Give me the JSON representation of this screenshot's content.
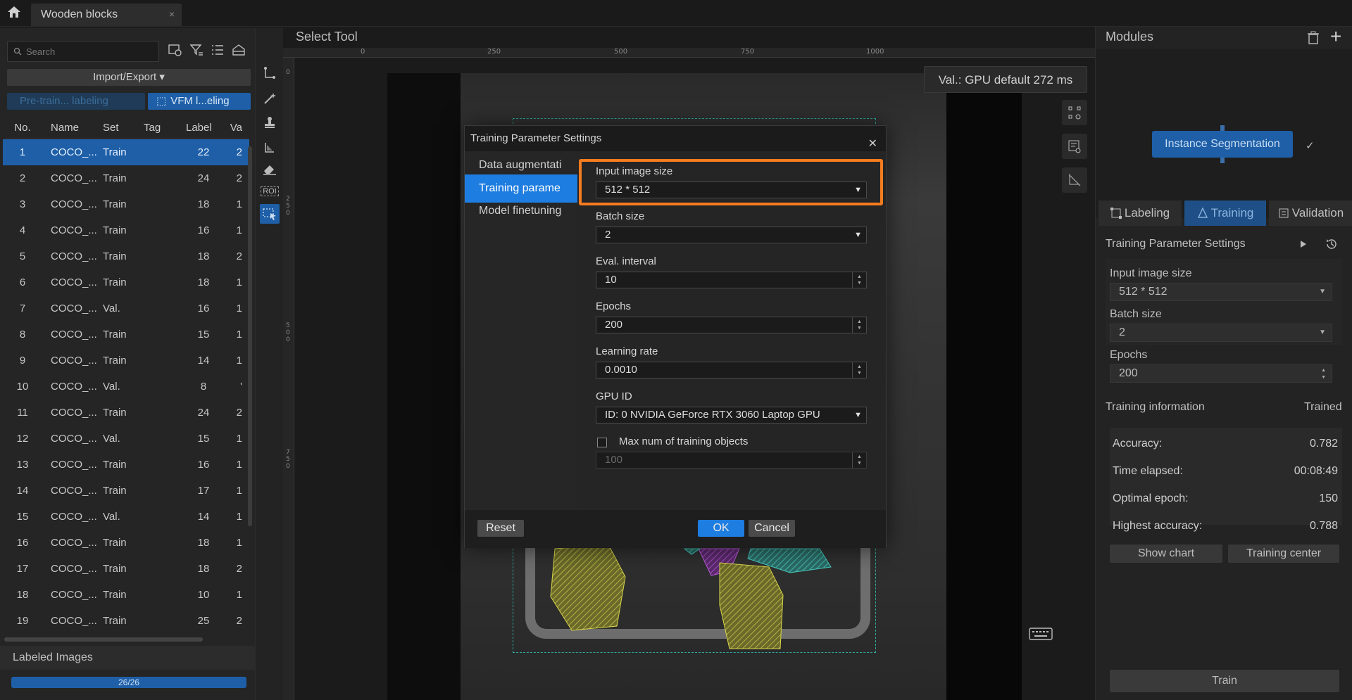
{
  "tab": {
    "title": "Wooden blocks",
    "close": "×"
  },
  "left": {
    "search_placeholder": "Search",
    "import_export": "Import/Export ▾",
    "pretrain_btn": "Pre-train... labeling",
    "vfm_btn": "VFM l...eling",
    "columns": [
      "No.",
      "Name",
      "Set",
      "Tag",
      "Label",
      "Va"
    ],
    "rows": [
      {
        "no": "1",
        "name": "COCO_...",
        "set": "Train",
        "label": "22",
        "val": "2"
      },
      {
        "no": "2",
        "name": "COCO_...",
        "set": "Train",
        "label": "24",
        "val": "2"
      },
      {
        "no": "3",
        "name": "COCO_...",
        "set": "Train",
        "label": "18",
        "val": "1"
      },
      {
        "no": "4",
        "name": "COCO_...",
        "set": "Train",
        "label": "16",
        "val": "1"
      },
      {
        "no": "5",
        "name": "COCO_...",
        "set": "Train",
        "label": "18",
        "val": "2"
      },
      {
        "no": "6",
        "name": "COCO_...",
        "set": "Train",
        "label": "18",
        "val": "1"
      },
      {
        "no": "7",
        "name": "COCO_...",
        "set": "Val.",
        "label": "16",
        "val": "1"
      },
      {
        "no": "8",
        "name": "COCO_...",
        "set": "Train",
        "label": "15",
        "val": "1"
      },
      {
        "no": "9",
        "name": "COCO_...",
        "set": "Train",
        "label": "14",
        "val": "1"
      },
      {
        "no": "10",
        "name": "COCO_...",
        "set": "Val.",
        "label": "8",
        "val": "'"
      },
      {
        "no": "11",
        "name": "COCO_...",
        "set": "Train",
        "label": "24",
        "val": "2"
      },
      {
        "no": "12",
        "name": "COCO_...",
        "set": "Val.",
        "label": "15",
        "val": "1"
      },
      {
        "no": "13",
        "name": "COCO_...",
        "set": "Train",
        "label": "16",
        "val": "1"
      },
      {
        "no": "14",
        "name": "COCO_...",
        "set": "Train",
        "label": "17",
        "val": "1"
      },
      {
        "no": "15",
        "name": "COCO_...",
        "set": "Val.",
        "label": "14",
        "val": "1"
      },
      {
        "no": "16",
        "name": "COCO_...",
        "set": "Train",
        "label": "18",
        "val": "1"
      },
      {
        "no": "17",
        "name": "COCO_...",
        "set": "Train",
        "label": "18",
        "val": "2"
      },
      {
        "no": "18",
        "name": "COCO_...",
        "set": "Train",
        "label": "10",
        "val": "1"
      },
      {
        "no": "19",
        "name": "COCO_...",
        "set": "Train",
        "label": "25",
        "val": "2"
      }
    ],
    "labeled_title": "Labeled Images",
    "progress_text": "26/26",
    "progress_fraction": 1.0
  },
  "vtoolbar": {
    "roi_label": "ROI"
  },
  "canvas": {
    "title": "Select Tool",
    "ruler_top": [
      "0",
      "250",
      "500",
      "750",
      "1000"
    ],
    "ruler_left": [
      "0",
      "250",
      "500",
      "750"
    ],
    "val_text": "Val.:  GPU default 272 ms"
  },
  "modules": {
    "title": "Modules",
    "node": "Instance Segmentation",
    "check": "✓"
  },
  "right_tabs": [
    "Labeling",
    "Training",
    "Validation"
  ],
  "training_params": {
    "title": "Training Parameter Settings",
    "input_size_label": "Input image size",
    "input_size_value": "512 * 512",
    "batch_label": "Batch size",
    "batch_value": "2",
    "epochs_label": "Epochs",
    "epochs_value": "200"
  },
  "training_info": {
    "title": "Training information",
    "status": "Trained",
    "accuracy_label": "Accuracy:",
    "accuracy_value": "0.782",
    "time_label": "Time elapsed:",
    "time_value": "00:08:49",
    "optimal_label": "Optimal epoch:",
    "optimal_value": "150",
    "highest_label": "Highest accuracy:",
    "highest_value": "0.788",
    "show_chart": "Show chart",
    "training_center": "Training center",
    "train_btn": "Train"
  },
  "modal": {
    "title": "Training Parameter Settings",
    "close": "✕",
    "nav": [
      "Data augmentati",
      "Training parame",
      "Model finetuning"
    ],
    "input_size_label": "Input image size",
    "input_size_value": "512 * 512",
    "batch_label": "Batch size",
    "batch_value": "2",
    "eval_label": "Eval. interval",
    "eval_value": "10",
    "epochs_label": "Epochs",
    "epochs_value": "200",
    "lr_label": "Learning rate",
    "lr_value": "0.0010",
    "gpu_label": "GPU ID",
    "gpu_value": "ID: 0  NVIDIA GeForce RTX 3060 Laptop GPU",
    "max_label": "Max num of training objects",
    "max_value": "100",
    "reset": "Reset",
    "ok": "OK",
    "cancel": "Cancel"
  },
  "colors": {
    "accent": "#1e7de0",
    "selection": "#1e5fa8",
    "highlight": "#f57c1f"
  }
}
